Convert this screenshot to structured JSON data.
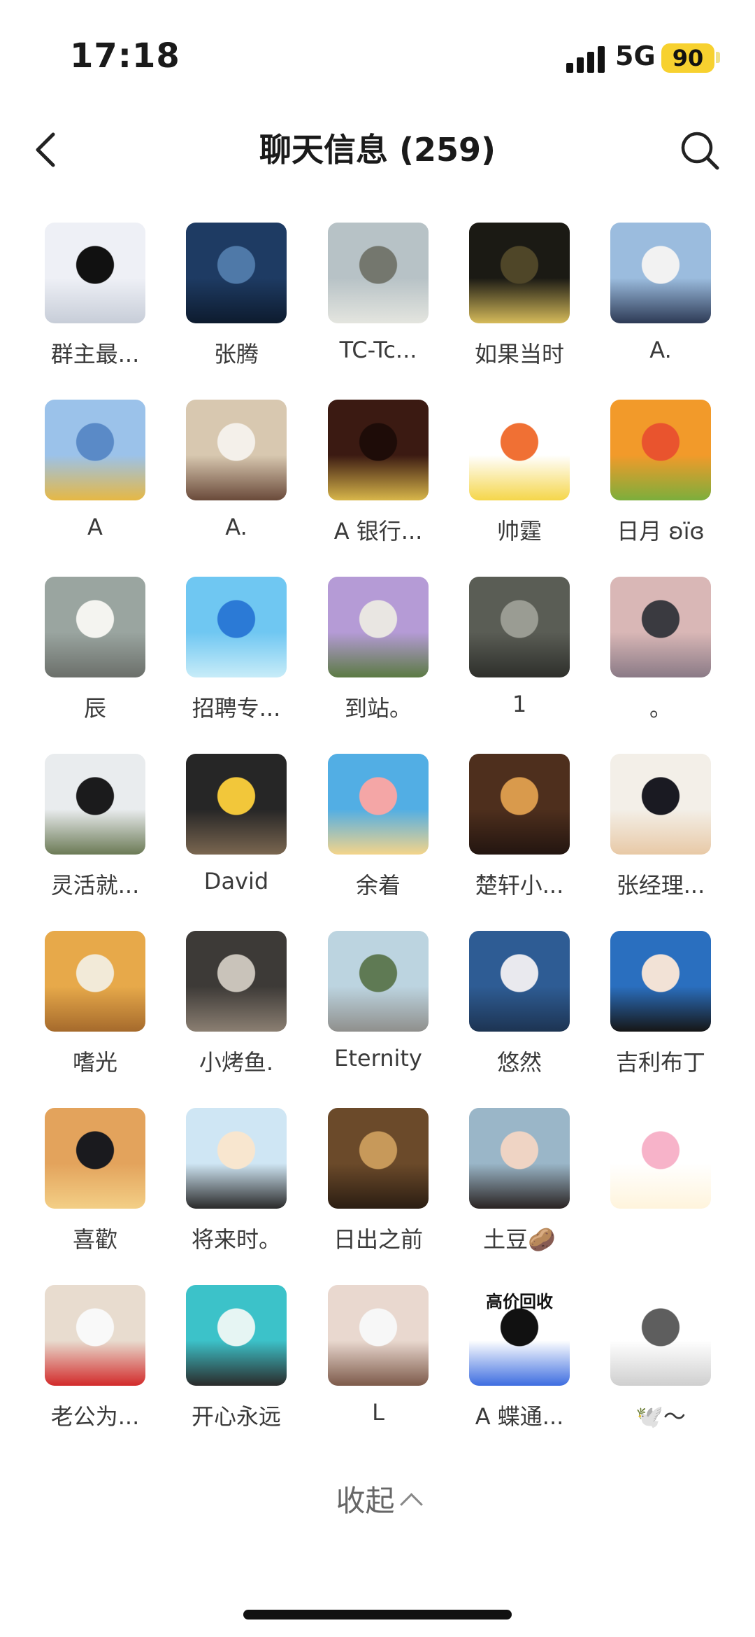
{
  "status": {
    "time": "17:18",
    "network": "5G",
    "battery": "90"
  },
  "header": {
    "title": "聊天信息 (259)"
  },
  "members": [
    {
      "name": "群主最...",
      "avatar": "anime-white-hair",
      "colors": [
        "#eef0f6",
        "#111111",
        "#c7cdd8"
      ]
    },
    {
      "name": "张腾",
      "avatar": "silhouette-sea",
      "colors": [
        "#1e3b63",
        "#4f79a8",
        "#0d1b2e"
      ]
    },
    {
      "name": "TC-Tc...",
      "avatar": "street-photo",
      "colors": [
        "#b7c2c6",
        "#74776e",
        "#e4e5df"
      ]
    },
    {
      "name": "如果当时",
      "avatar": "night-map",
      "colors": [
        "#1b1a14",
        "#4f4628",
        "#d6bb5a"
      ]
    },
    {
      "name": "A.",
      "avatar": "masked-person",
      "colors": [
        "#9bbcde",
        "#f2f2f2",
        "#2d3a55"
      ]
    },
    {
      "name": "A",
      "avatar": "stitch-mountain",
      "colors": [
        "#9bc2ea",
        "#5a8ac7",
        "#e6b844"
      ]
    },
    {
      "name": "A.",
      "avatar": "child-hellokitty",
      "colors": [
        "#d8c8b0",
        "#f4f0ea",
        "#6a4a3a"
      ]
    },
    {
      "name": "A 银行...",
      "avatar": "gold-calligraphy",
      "colors": [
        "#3b1a12",
        "#1e0c08",
        "#d8b64a"
      ]
    },
    {
      "name": "帅霆",
      "avatar": "fuecoco",
      "colors": [
        "#ffffff",
        "#f07034",
        "#f5d64a"
      ]
    },
    {
      "name": "日月 ʚïɞ",
      "avatar": "citrus-fruits",
      "colors": [
        "#f29a2a",
        "#e9542e",
        "#7cae3c"
      ]
    },
    {
      "name": "辰",
      "avatar": "white-bear",
      "colors": [
        "#9aa5a0",
        "#f4f4f0",
        "#6b6f6a"
      ]
    },
    {
      "name": "招聘专...",
      "avatar": "blue-swirl",
      "colors": [
        "#6fc7f2",
        "#2b7ad6",
        "#c8ecf8"
      ]
    },
    {
      "name": "到站。",
      "avatar": "anime-purple-hair",
      "colors": [
        "#b59bd6",
        "#e9e6e2",
        "#5b7a43"
      ]
    },
    {
      "name": "1",
      "avatar": "kitten-grey",
      "colors": [
        "#5a5d55",
        "#9a9c93",
        "#2e2f2b"
      ]
    },
    {
      "name": "。",
      "avatar": "car-window",
      "colors": [
        "#d9b7b6",
        "#3a3a40",
        "#8a7a86"
      ]
    },
    {
      "name": "灵活就...",
      "avatar": "volcano-car",
      "colors": [
        "#e9ecee",
        "#1b1b1c",
        "#6b7a55"
      ]
    },
    {
      "name": "David",
      "avatar": "lego-person",
      "colors": [
        "#262626",
        "#f2c73a",
        "#7a6650"
      ]
    },
    {
      "name": "余着",
      "avatar": "patrick-star",
      "colors": [
        "#52aee4",
        "#f4a6a6",
        "#f4d48a"
      ]
    },
    {
      "name": "楚轩小...",
      "avatar": "cat-sunlight",
      "colors": [
        "#4e2f1d",
        "#d99a4c",
        "#231510"
      ]
    },
    {
      "name": "张经理...",
      "avatar": "suit-man",
      "colors": [
        "#f3efe8",
        "#1a1a22",
        "#e8c9a6"
      ]
    },
    {
      "name": "嗜光",
      "avatar": "shiba-dogs",
      "colors": [
        "#e7a94a",
        "#f2ead8",
        "#a56a2c"
      ]
    },
    {
      "name": "小烤鱼.",
      "avatar": "girl-car",
      "colors": [
        "#3d3a37",
        "#c9c3ba",
        "#8b7f72"
      ]
    },
    {
      "name": "Eternity",
      "avatar": "trees-street",
      "colors": [
        "#bcd4e0",
        "#5f7a54",
        "#8f8f8c"
      ]
    },
    {
      "name": "悠然",
      "avatar": "girl-seaside",
      "colors": [
        "#2e5c94",
        "#e9e9ee",
        "#1d3452"
      ]
    },
    {
      "name": "吉利布丁",
      "avatar": "girl-portrait",
      "colors": [
        "#2a6fbf",
        "#f2e2d6",
        "#161616"
      ]
    },
    {
      "name": "喜歡",
      "avatar": "sunset-couple",
      "colors": [
        "#e3a35c",
        "#1a1a1e",
        "#f3cf86"
      ]
    },
    {
      "name": "将来时。",
      "avatar": "cartoon-baby",
      "colors": [
        "#cfe6f4",
        "#f8e6cf",
        "#2a2a2a"
      ]
    },
    {
      "name": "日出之前",
      "avatar": "cat-glasses",
      "colors": [
        "#6b4a2a",
        "#c7995a",
        "#2b1d12"
      ]
    },
    {
      "name": "土豆🥔",
      "avatar": "girl-beach",
      "colors": [
        "#9ab6c8",
        "#efd4c4",
        "#2a2322"
      ]
    },
    {
      "name": "",
      "avatar": "pink-hair-chibi",
      "colors": [
        "#ffffff",
        "#f7b3c9",
        "#fff4dc"
      ]
    },
    {
      "name": "老公为...",
      "avatar": "hellokitty-costume",
      "colors": [
        "#e8dccf",
        "#f9f9f9",
        "#d22a2a"
      ]
    },
    {
      "name": "开心永远",
      "avatar": "girl-pool",
      "colors": [
        "#3cc2c9",
        "#e6f5f3",
        "#2a2a2a"
      ]
    },
    {
      "name": "L",
      "avatar": "rabbit-face",
      "colors": [
        "#e9d8cf",
        "#f7f7f7",
        "#7d5a4a"
      ]
    },
    {
      "name": "A 蝶通...",
      "avatar": "phone-ad",
      "ad_title": "高价回收",
      "colors": [
        "#ffffff",
        "#111111",
        "#3d6de0"
      ]
    },
    {
      "name": "🕊️～",
      "avatar": "sketch-cat",
      "colors": [
        "#ffffff",
        "#5e5e5e",
        "#cfcfcf"
      ]
    }
  ],
  "collapse_label": "收起"
}
